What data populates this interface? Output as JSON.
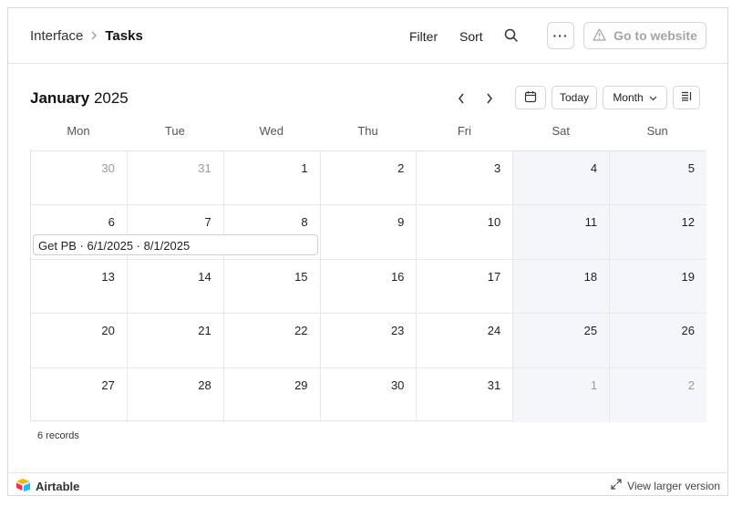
{
  "header": {
    "breadcrumb_root": "Interface",
    "breadcrumb_current": "Tasks",
    "filter_label": "Filter",
    "sort_label": "Sort",
    "more_label": "···",
    "go_website_label": "Go to website"
  },
  "calendar": {
    "month": "January",
    "year": "2025",
    "today_label": "Today",
    "view_label": "Month",
    "weekdays": [
      "Mon",
      "Tue",
      "Wed",
      "Thu",
      "Fri",
      "Sat",
      "Sun"
    ],
    "weeks": [
      [
        {
          "d": "30",
          "muted": true
        },
        {
          "d": "31",
          "muted": true
        },
        {
          "d": "1"
        },
        {
          "d": "2"
        },
        {
          "d": "3"
        },
        {
          "d": "4"
        },
        {
          "d": "5"
        }
      ],
      [
        {
          "d": "6"
        },
        {
          "d": "7"
        },
        {
          "d": "8"
        },
        {
          "d": "9"
        },
        {
          "d": "10"
        },
        {
          "d": "11"
        },
        {
          "d": "12"
        }
      ],
      [
        {
          "d": "13"
        },
        {
          "d": "14"
        },
        {
          "d": "15"
        },
        {
          "d": "16"
        },
        {
          "d": "17"
        },
        {
          "d": "18"
        },
        {
          "d": "19"
        }
      ],
      [
        {
          "d": "20"
        },
        {
          "d": "21"
        },
        {
          "d": "22"
        },
        {
          "d": "23"
        },
        {
          "d": "24"
        },
        {
          "d": "25"
        },
        {
          "d": "26"
        }
      ],
      [
        {
          "d": "27"
        },
        {
          "d": "28"
        },
        {
          "d": "29"
        },
        {
          "d": "30"
        },
        {
          "d": "31"
        },
        {
          "d": "1",
          "muted": true
        },
        {
          "d": "2",
          "muted": true
        }
      ]
    ],
    "event_label": "Get PB · 6/1/2025 · 8/1/2025"
  },
  "records_count": "6 records",
  "footer": {
    "brand": "Airtable",
    "larger_view": "View larger version"
  },
  "colors": {
    "weekend_bg": "#f5f6fa",
    "muted_text": "#9a9a9a"
  }
}
